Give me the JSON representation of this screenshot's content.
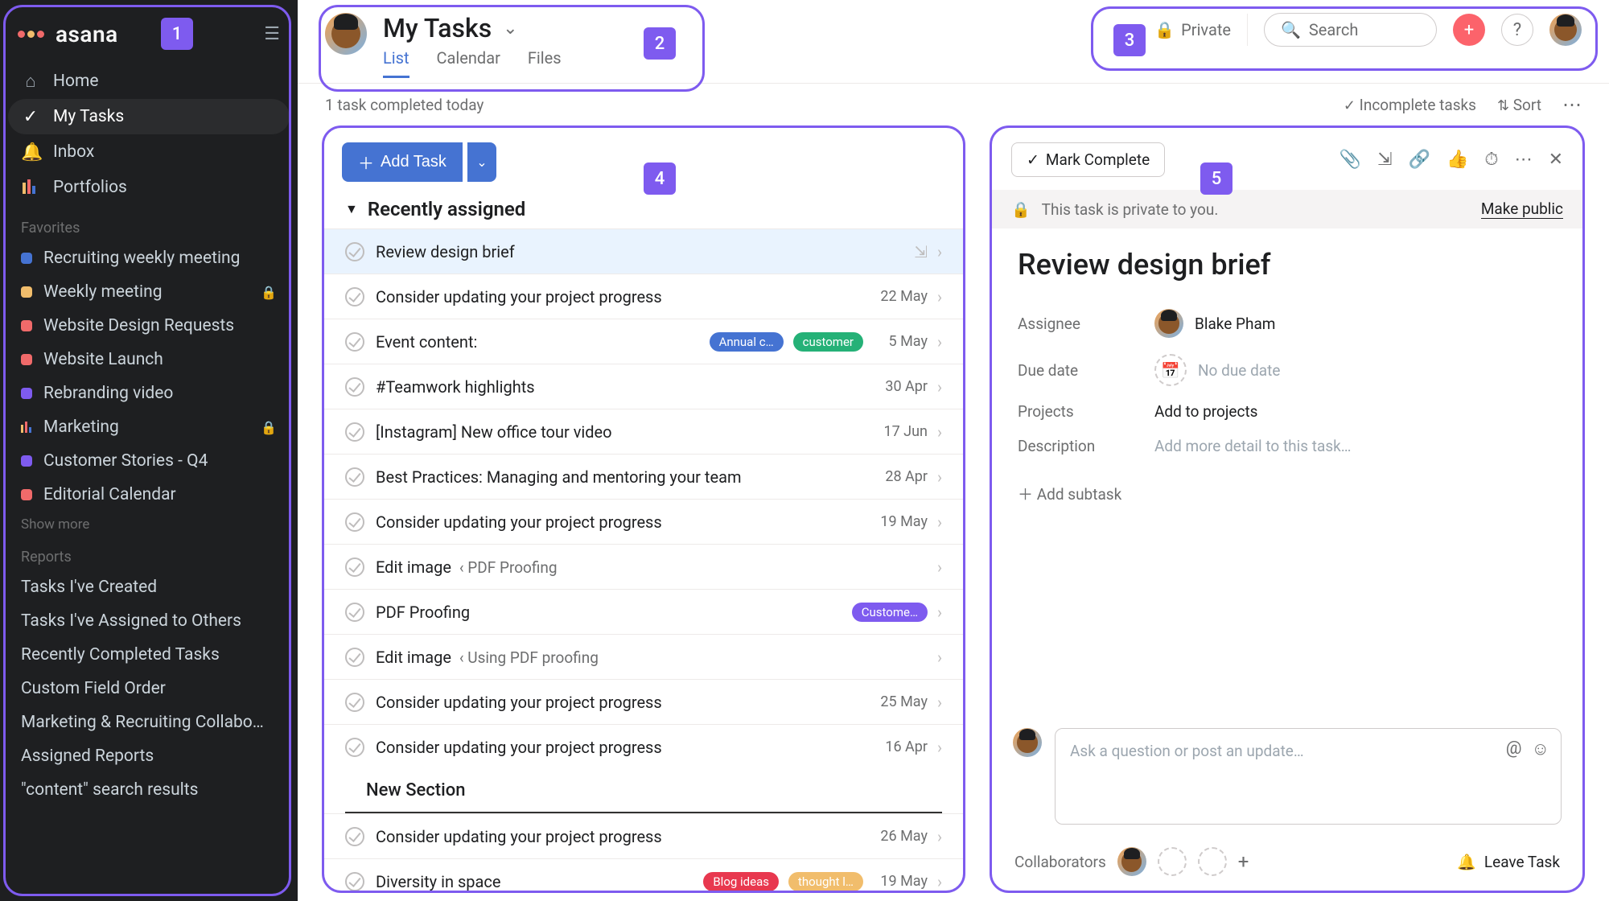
{
  "sidebar": {
    "brand": "asana",
    "nav": [
      {
        "icon": "home-icon",
        "label": "Home"
      },
      {
        "icon": "check-circle-icon",
        "label": "My Tasks",
        "active": true
      },
      {
        "icon": "bell-icon",
        "label": "Inbox"
      },
      {
        "icon": "bars-icon",
        "label": "Portfolios"
      }
    ],
    "favorites_label": "Favorites",
    "favorites": [
      {
        "color": "#4573d2",
        "label": "Recruiting weekly meeting"
      },
      {
        "color": "#f1bd6c",
        "label": "Weekly meeting",
        "locked": true
      },
      {
        "color": "#f06a6a",
        "label": "Website Design Requests"
      },
      {
        "color": "#f06a6a",
        "label": "Website Launch"
      },
      {
        "color": "#7e5bef",
        "label": "Rebranding video"
      },
      {
        "color": "bars",
        "label": "Marketing",
        "locked": true
      },
      {
        "color": "#7e5bef",
        "label": "Customer Stories - Q4"
      },
      {
        "color": "#f06a6a",
        "label": "Editorial Calendar"
      }
    ],
    "show_more": "Show more",
    "reports_label": "Reports",
    "reports": [
      "Tasks I've Created",
      "Tasks I've Assigned to Others",
      "Recently Completed Tasks",
      "Custom Field Order",
      "Marketing & Recruiting Collabo…",
      "Assigned Reports",
      "\"content\" search results"
    ]
  },
  "header": {
    "title": "My Tasks",
    "tabs": [
      "List",
      "Calendar",
      "Files"
    ],
    "active_tab": "List",
    "private": "Private",
    "search_placeholder": "Search"
  },
  "subbar": {
    "status": "1 task completed today",
    "filter": "Incomplete tasks",
    "sort": "Sort"
  },
  "task_list": {
    "add_task": "Add Task",
    "sections": [
      {
        "name": "Recently assigned",
        "tasks": [
          {
            "name": "Review design brief",
            "selected": true,
            "subs_icon": true
          },
          {
            "name": "Consider updating your project progress",
            "date": "22 May"
          },
          {
            "name": "Event content:",
            "date": "5 May",
            "pills": [
              {
                "text": "Annual c…",
                "color": "#4573d2"
              },
              {
                "text": "customer",
                "color": "#25b177"
              }
            ]
          },
          {
            "name": "#Teamwork highlights",
            "date": "30 Apr"
          },
          {
            "name": "[Instagram] New office tour video",
            "date": "17 Jun"
          },
          {
            "name": "Best Practices: Managing and mentoring your team",
            "date": "28 Apr"
          },
          {
            "name": "Consider updating your project progress",
            "date": "19 May"
          },
          {
            "name": "Edit image",
            "crumb": "‹ PDF Proofing"
          },
          {
            "name": "PDF Proofing",
            "pills": [
              {
                "text": "Custome…",
                "color": "#7e5bef"
              }
            ]
          },
          {
            "name": "Edit image",
            "crumb": "‹ Using PDF proofing"
          },
          {
            "name": "Consider updating your project progress",
            "date": "25 May"
          },
          {
            "name": "Consider updating your project progress",
            "date": "16 Apr"
          }
        ]
      },
      {
        "name": "New Section",
        "tasks": [
          {
            "name": "Consider updating your project progress",
            "date": "26 May"
          },
          {
            "name": "Diversity in space",
            "date": "19 May",
            "pills": [
              {
                "text": "Blog ideas",
                "color": "#e8384f"
              },
              {
                "text": "thought l…",
                "color": "#f1bd6c"
              }
            ]
          }
        ]
      }
    ]
  },
  "detail": {
    "mark_complete": "Mark Complete",
    "private_msg": "This task is private to you.",
    "make_public": "Make public",
    "title": "Review design brief",
    "assignee": {
      "label": "Assignee",
      "value": "Blake Pham"
    },
    "due_date": {
      "label": "Due date",
      "value": "No due date"
    },
    "projects": {
      "label": "Projects",
      "value": "Add to projects"
    },
    "description": {
      "label": "Description",
      "placeholder": "Add more detail to this task…"
    },
    "add_subtask": "Add subtask",
    "comment_placeholder": "Ask a question or post an update…",
    "collaborators_label": "Collaborators",
    "leave_task": "Leave Task"
  },
  "annotations": {
    "1": "1",
    "2": "2",
    "3": "3",
    "4": "4",
    "5": "5"
  }
}
